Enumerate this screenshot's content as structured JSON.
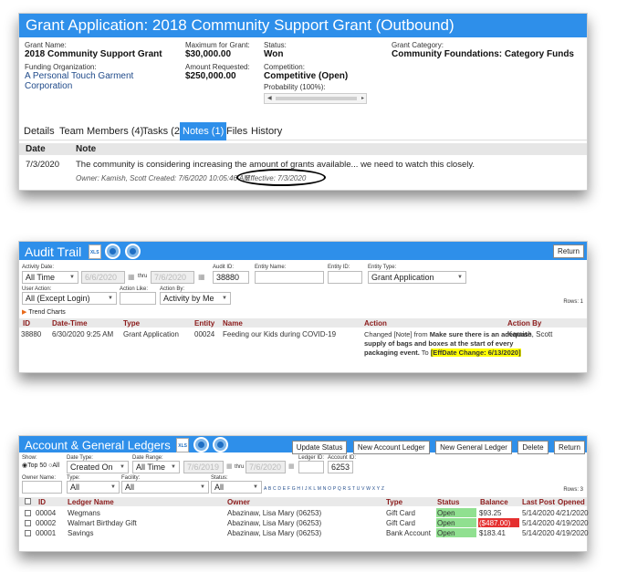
{
  "grant": {
    "title": "Grant Application: 2018 Community Support Grant (Outbound)",
    "grant_name_label": "Grant Name:",
    "grant_name": "2018 Community Support Grant",
    "funding_org_label": "Funding Organization:",
    "funding_org": "A Personal Touch Garment Corporation",
    "max_label": "Maximum for Grant:",
    "max_value": "$30,000.00",
    "requested_label": "Amount Requested:",
    "requested_value": "$250,000.00",
    "status_label": "Status:",
    "status_value": "Won",
    "competition_label": "Competition:",
    "competition_value": "Competitive (Open)",
    "probability_label": "Probability (100%):",
    "category_label": "Grant Category:",
    "category_value": "Community Foundations: Category Funds",
    "tabs": [
      "Details",
      "Team Members (4)",
      "Tasks (2)",
      "Notes (1)",
      "Files",
      "History"
    ],
    "active_tab": "Notes (1)",
    "notes_headers": {
      "date": "Date",
      "note": "Note"
    },
    "note": {
      "date": "7/3/2020",
      "text": "The community is considering increasing the amount of grants available... we need to watch this closely.",
      "meta": "Owner: Kamish, Scott Created: 7/6/2020 10:05:46 AM",
      "effective": "Effective: 7/3/2020"
    }
  },
  "audit": {
    "title": "Audit Trail",
    "return_label": "Return",
    "activity_date_label": "Activity Date:",
    "activity_date_value": "All Time",
    "date_from": "6/6/2020",
    "thru_label": "thru",
    "date_to": "7/6/2020",
    "audit_id_label": "Audit ID:",
    "audit_id_value": "38880",
    "entity_name_label": "Entity Name:",
    "entity_id_label": "Entity ID:",
    "entity_type_label": "Entity Type:",
    "entity_type_value": "Grant Application",
    "user_action_label": "User Action:",
    "user_action_value": "All (Except Login)",
    "action_like_label": "Action Like:",
    "action_by_label": "Action By:",
    "action_by_value": "Activity by Me",
    "rows_label": "Rows: 1",
    "trend_label": "Trend Charts",
    "headers": [
      "ID",
      "Date-Time",
      "Type",
      "Entity",
      "Name",
      "Action",
      "Action By"
    ],
    "row": {
      "id": "38880",
      "datetime": "6/30/2020 9:25 AM",
      "type": "Grant Application",
      "entity": "00024",
      "name": "Feeding our Kids during COVID-19",
      "action_prefix": "Changed [Note] from ",
      "action_bold": "Make sure there is an adequate supply of bags and boxes at the start of every packaging event.",
      "action_to": " To ",
      "action_highlight": "[EffDate Change: 6/13/2020]",
      "action_by": "Kamish, Scott"
    }
  },
  "ledgers": {
    "title": "Account & General Ledgers",
    "buttons": [
      "Update Status",
      "New Account Ledger",
      "New General Ledger",
      "Delete",
      "Return"
    ],
    "show_label": "Show:",
    "top50_label": "Top 50",
    "all_label": "All",
    "date_type_label": "Date Type:",
    "date_type_value": "Created On",
    "date_range_label": "Date Range:",
    "date_range_value": "All Time",
    "date_from": "7/6/2019",
    "thru_label": "thru",
    "date_to": "7/6/2020",
    "ledger_id_label": "Ledger ID:",
    "account_id_label": "Account ID:",
    "account_id_value": "6253",
    "owner_name_label": "Owner Name:",
    "type_label": "Type:",
    "type_value": "All",
    "facility_label": "Facility:",
    "facility_value": "All",
    "status_label": "Status:",
    "status_value": "All",
    "alphabet": "A B C D E F G H I J K L M N O P Q R S T U V W X Y Z",
    "rows_label": "Rows: 3",
    "headers": [
      "ID",
      "Ledger Name",
      "Owner",
      "Type",
      "Status",
      "Balance",
      "Last Post",
      "Opened"
    ],
    "rows": [
      {
        "id": "00004",
        "name": "Wegmans",
        "owner": "Abazinaw, Lisa Mary (06253)",
        "type": "Gift Card",
        "status": "Open",
        "balance": "$93.25",
        "last_post": "5/14/2020",
        "opened": "4/21/2020",
        "neg": false
      },
      {
        "id": "00002",
        "name": "Walmart Birthday Gift",
        "owner": "Abazinaw, Lisa Mary (06253)",
        "type": "Gift Card",
        "status": "Open",
        "balance": "($487.00)",
        "last_post": "5/14/2020",
        "opened": "4/19/2020",
        "neg": true
      },
      {
        "id": "00001",
        "name": "Savings",
        "owner": "Abazinaw, Lisa Mary (06253)",
        "type": "Bank Account",
        "status": "Open",
        "balance": "$183.41",
        "last_post": "5/14/2020",
        "opened": "4/19/2020",
        "neg": false
      }
    ]
  }
}
